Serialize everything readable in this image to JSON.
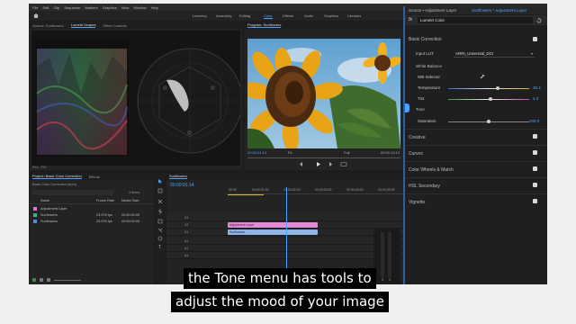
{
  "menu": [
    "File",
    "Edit",
    "Clip",
    "Sequence",
    "Markers",
    "Graphics",
    "View",
    "Window",
    "Help"
  ],
  "workspaces": [
    "Learning",
    "Assembly",
    "Editing",
    "Color",
    "Effects",
    "Audio",
    "Graphics",
    "Libraries"
  ],
  "active_workspace": "Color",
  "scopes_panel": {
    "tabs": [
      "Source: Sunflowers",
      "Lumetri Scopes",
      "Effect Controls"
    ],
    "active_tab": "Lumetri Scopes",
    "footer_label": "Rec. 709"
  },
  "program_monitor": {
    "title": "Program: Sunflowers",
    "timecode": "00:00:01:14",
    "fit": "Fit",
    "quality": "Full",
    "duration": "00:00:13:13"
  },
  "project_panel": {
    "tabs": [
      "Project: Basic Color Correction",
      "Effects"
    ],
    "project_file": "Basic Color Correction.prproj",
    "item_count": "3 items",
    "columns": [
      "Name",
      "Frame Rate",
      "Media Start"
    ],
    "rows": [
      {
        "name": "Adjustment Layer",
        "rate": "",
        "start": "",
        "color": "#e36fd0"
      },
      {
        "name": "Sunflowers",
        "rate": "23.976 fps",
        "start": "00:00:00:00",
        "color": "#36b88a"
      },
      {
        "name": "Sunflowers",
        "rate": "23.976 fps",
        "start": "00:00:00:00",
        "color": "#4a90d9"
      }
    ]
  },
  "timeline": {
    "sequence": "Sunflowers",
    "timecode": "00:00:01:14",
    "ruler": [
      "00:00",
      "00:00:01:00",
      "00:00:02:00",
      "00:00:03:00",
      "00:00:04:00",
      "00:00:05:00"
    ],
    "track_labels": [
      "V3",
      "V2",
      "V1",
      "A1",
      "A2",
      "A3"
    ],
    "clips": [
      {
        "name": "Adjustment Layer",
        "color": "#e48ad6"
      },
      {
        "name": "Sunflowers",
        "color": "#8fb4e6"
      }
    ],
    "meter_labels": [
      "S",
      "S"
    ]
  },
  "lumetri": {
    "panel_title": "Source • Adjustment Layer",
    "sequence_title": "Sunflowers * Adjustment Layer",
    "effect": "Lumetri Color",
    "basic_correction": "Basic Correction",
    "input_lut_label": "Input LUT",
    "input_lut_value": "ARRI_Universal_DCI",
    "white_balance": "White Balance",
    "wb_selector": "WB Selector",
    "temperature_label": "Temperature",
    "temperature_value": "30.4",
    "tint_label": "Tint",
    "tint_value": "4.3",
    "tone": "Tone",
    "saturation_label": "Saturation",
    "saturation_value": "100.0",
    "sections": [
      "Creative",
      "Curves",
      "Color Wheels & Match",
      "HSL Secondary",
      "Vignette"
    ],
    "accent": "#4da3ff"
  },
  "captions": {
    "line1": "the Tone menu has tools to",
    "line2": "adjust the mood of your image"
  },
  "icons": [
    "home-icon",
    "lumetri-fx-icon",
    "reset-icon",
    "eyedropper-icon",
    "play-icon",
    "step-back-icon",
    "step-forward-icon",
    "camera-icon",
    "selection-tool-icon",
    "razor-tool-icon",
    "hand-tool-icon",
    "text-tool-icon"
  ]
}
